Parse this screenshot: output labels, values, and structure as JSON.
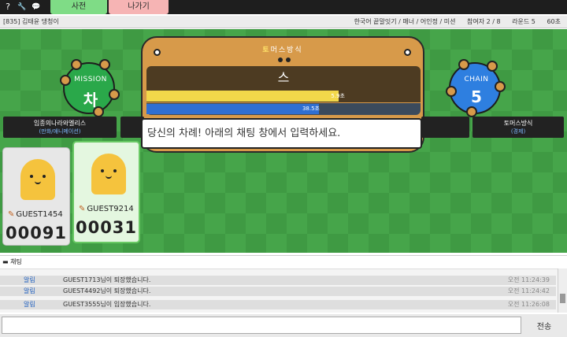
{
  "topbar": {
    "icons": [
      "help-icon",
      "wrench-icon",
      "chat-bubble-icon"
    ],
    "help_glyph": "?",
    "wrench_glyph": "🔧",
    "chat_glyph": "💬",
    "dict_label": "사전",
    "exit_label": "나가기"
  },
  "room": {
    "title": "[835] 김태윤 댕청이",
    "mode": "한국어 끝말잇기 / 매너 / 어인정 / 미션",
    "players": "참여자 2 / 8",
    "round": "라운드 5",
    "seconds": "60초"
  },
  "mission": {
    "label": "MISSION",
    "char": "차"
  },
  "chain": {
    "label": "CHAIN",
    "count": "5"
  },
  "board": {
    "header_first": "토",
    "header_rest": "머스방식",
    "current_char": "스",
    "round_timer": {
      "label": "5.9초",
      "fraction": 0.7
    },
    "turn_timer": {
      "label": "38.5초",
      "fraction": 0.63
    },
    "turn_message": "당신의 차례! 아래의 채팅 창에서 입력하세요."
  },
  "infobox_left": {
    "word": "임종의나라와엘리스",
    "category": "(만화/애니메이션)"
  },
  "infobox_right": {
    "word": "토머스방식",
    "category": "(경제)"
  },
  "players": [
    {
      "name": "GUEST1454",
      "score": "00091"
    },
    {
      "name": "GUEST9214",
      "score": "00031"
    }
  ],
  "chat": {
    "header": "채팅",
    "rows": [
      {
        "who": "알림",
        "msg": "GUEST1713님이 퇴장했습니다.",
        "time": "오전 11:24:39"
      },
      {
        "who": "알림",
        "msg": "GUEST4492님이 퇴장했습니다.",
        "time": "오전 11:24:42"
      },
      {
        "who": "알림",
        "msg": "GUEST3555님이 입장했습니다.",
        "time": "오전 11:26:08"
      }
    ],
    "input_value": "",
    "send_label": "전송"
  },
  "colors": {
    "game_bg": "#3f9a43",
    "mission_blob": "#2aa84a",
    "chain_blob": "#2e7fe0",
    "board": "#d79a4a",
    "yellow_bar": "#f2d84a",
    "blue_bar": "#2f6fd2",
    "dict_tab": "#7fdc86",
    "exit_tab": "#f6b4b4"
  }
}
